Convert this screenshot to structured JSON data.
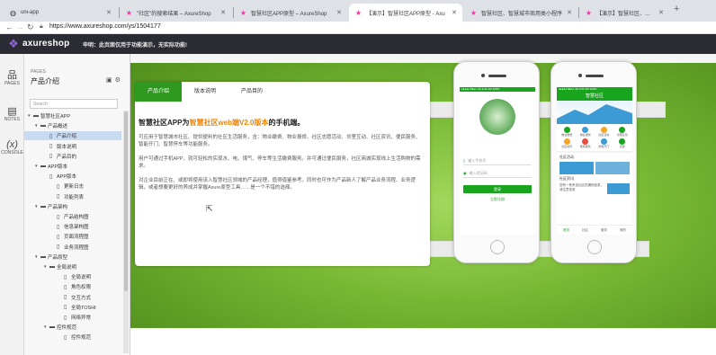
{
  "browser": {
    "tabs": [
      {
        "title": "uni-app",
        "active": false
      },
      {
        "title": "\"社区\"的搜索结果 – AxureShop",
        "active": false
      },
      {
        "title": "智慧社区APP原型 – AxureShop",
        "active": false
      },
      {
        "title": "【演示】智慧社区APP原型 - Axu",
        "active": true
      },
      {
        "title": "智慧社区、智慧城市商用类小程序",
        "active": false
      },
      {
        "title": "【演示】智慧社区、智慧城市商用",
        "active": false
      }
    ],
    "url": "https://www.axureshop.com/ys/1504177"
  },
  "topbar": {
    "brand": "axureshop",
    "notice": "申明：此页面仅用于功能演示，无实际功能!"
  },
  "rail": {
    "pages": "PAGES",
    "notes": "NOTES",
    "console": "CONSOLE"
  },
  "panel": {
    "section": "PAGES",
    "title": "产品介绍",
    "search_placeholder": "Search",
    "tree": [
      {
        "label": "智慧社区APP",
        "level": 0,
        "type": "folder",
        "open": true
      },
      {
        "label": "产品概述",
        "level": 1,
        "type": "folder",
        "open": true
      },
      {
        "label": "产品介绍",
        "level": 2,
        "type": "page",
        "selected": true
      },
      {
        "label": "版本说明",
        "level": 2,
        "type": "page"
      },
      {
        "label": "产品目的",
        "level": 2,
        "type": "page"
      },
      {
        "label": "APP版本",
        "level": 1,
        "type": "folder",
        "open": true
      },
      {
        "label": "APP版本",
        "level": 2,
        "type": "page",
        "open": true
      },
      {
        "label": "更新日志",
        "level": 3,
        "type": "page"
      },
      {
        "label": "功能列表",
        "level": 3,
        "type": "page"
      },
      {
        "label": "产品架构",
        "level": 1,
        "type": "folder",
        "open": true
      },
      {
        "label": "产品结构图",
        "level": 3,
        "type": "page"
      },
      {
        "label": "信息架构图",
        "level": 3,
        "type": "page"
      },
      {
        "label": "页面流程图",
        "level": 3,
        "type": "page"
      },
      {
        "label": "业务流程图",
        "level": 3,
        "type": "page"
      },
      {
        "label": "产品原型",
        "level": 1,
        "type": "folder",
        "open": true
      },
      {
        "label": "全局说明",
        "level": 2,
        "type": "folder",
        "open": true
      },
      {
        "label": "全局说明",
        "level": 4,
        "type": "page"
      },
      {
        "label": "角色权限",
        "level": 4,
        "type": "page"
      },
      {
        "label": "交互方式",
        "level": 4,
        "type": "page"
      },
      {
        "label": "全局TOSHI",
        "level": 4,
        "type": "page"
      },
      {
        "label": "网络异常",
        "level": 4,
        "type": "page"
      },
      {
        "label": "控件规范",
        "level": 2,
        "type": "folder",
        "open": true
      },
      {
        "label": "控件规范",
        "level": 4,
        "type": "page"
      }
    ]
  },
  "card": {
    "tabs": [
      "产品介绍",
      "版本说明",
      "产品目的"
    ],
    "active_tab": 0,
    "title_a": "智慧社区APP为",
    "title_hl": "智慧社区web端V2.0版本",
    "title_b": "的手机端。",
    "p1": "可应用于智慧城市社区、提供便利的社区生活服务，含：物业缴费、物业报修、社区志愿活动、邻里互动、社区资讯、便民服务、智能开门、智慧停车等功能服务。",
    "p2": "用户可通过手机APP，就可轻松的实现水、电、煤气、停车等生活缴费服务。并可通过便民服务，社区商城实现线上生活购物的需求。",
    "p3": "对企业目前正在、或即将使用该入智慧社区领域的产品经理，值得借鉴参考。同时也可作为产品新人了解产品业务流程、业务逻辑，或者想要更好的养成并掌握Axure原型工具……是一个不错的选择。"
  },
  "phone_left": {
    "status": "●●●●● BELL  4G   9:41 AM   100%",
    "phone_placeholder": "输入手机号",
    "code_placeholder": "输入验证码",
    "login": "登录",
    "register": "立即注册"
  },
  "phone_right": {
    "status": "●●●●● BELL  4G   9:41 AM   100%",
    "title": "智慧社区",
    "icons": [
      "物业缴费",
      "物业报修",
      "社区活动",
      "邻里互动",
      "社区资讯",
      "便民服务",
      "智能开门",
      "全部"
    ],
    "section1": "社区活动",
    "section2": "社区资讯",
    "news": "您有一条来自社区的通知信息，请注意查收",
    "bottom_nav": [
      "首页",
      "社区",
      "服务",
      "我的"
    ]
  },
  "colors": {
    "accent": "#2d9a1f",
    "highlight": "#f08300",
    "topbar": "#2b2b33"
  }
}
